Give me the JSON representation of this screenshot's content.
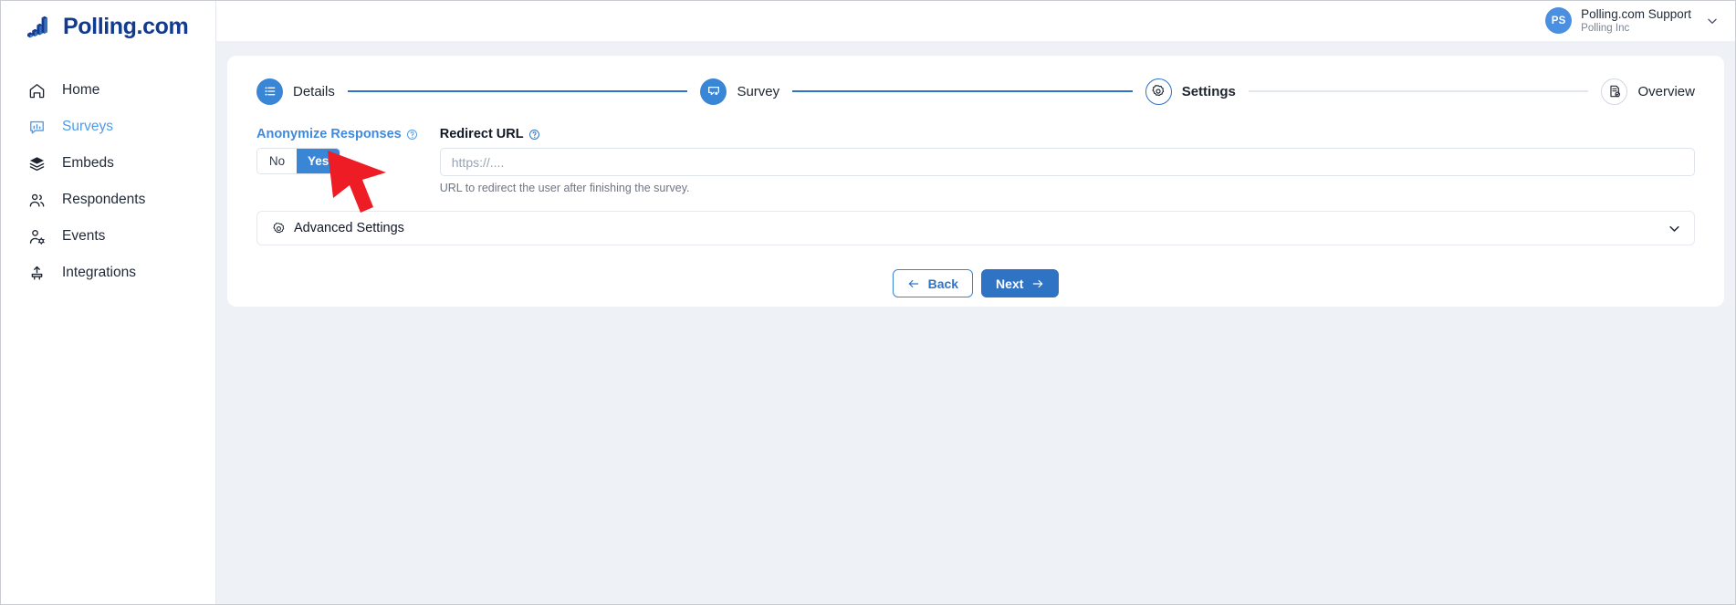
{
  "brand": {
    "name": "Polling.com",
    "logo_icon": "bar-chart-logo-icon"
  },
  "sidebar": {
    "items": [
      {
        "label": "Home",
        "icon": "home-icon",
        "active": false
      },
      {
        "label": "Surveys",
        "icon": "survey-chart-icon",
        "active": true
      },
      {
        "label": "Embeds",
        "icon": "layers-icon",
        "active": false
      },
      {
        "label": "Respondents",
        "icon": "users-icon",
        "active": false
      },
      {
        "label": "Events",
        "icon": "user-gear-icon",
        "active": false
      },
      {
        "label": "Integrations",
        "icon": "plug-upload-icon",
        "active": false
      }
    ]
  },
  "topbar": {
    "account": {
      "initials": "PS",
      "name": "Polling.com Support",
      "org": "Polling Inc",
      "caret_icon": "chevron-down-icon"
    }
  },
  "stepper": {
    "steps": [
      {
        "label": "Details",
        "icon": "list-icon",
        "state": "done"
      },
      {
        "label": "Survey",
        "icon": "survey-search-icon",
        "state": "done"
      },
      {
        "label": "Settings",
        "icon": "gear-icon",
        "state": "current"
      },
      {
        "label": "Overview",
        "icon": "document-check-icon",
        "state": "todo"
      }
    ]
  },
  "form": {
    "anonymize": {
      "label": "Anonymize Responses",
      "help_icon": "help-circle-icon",
      "options": [
        "No",
        "Yes"
      ],
      "selected": "Yes"
    },
    "redirect_url": {
      "label": "Redirect URL",
      "help_icon": "help-circle-icon",
      "value": "",
      "placeholder": "https://....",
      "hint": "URL to redirect the user after finishing the survey."
    },
    "advanced": {
      "label": "Advanced Settings",
      "gear_icon": "gear-icon",
      "chevron_icon": "chevron-down-icon",
      "expanded": false
    }
  },
  "actions": {
    "back_label": "Back",
    "back_icon": "arrow-left-icon",
    "next_label": "Next",
    "next_icon": "arrow-right-icon"
  },
  "annotation": {
    "cursor_icon": "red-cursor-arrow",
    "color": "#ee1c25"
  },
  "colors": {
    "accent_blue": "#2f73c4",
    "step_blue": "#3a86d6",
    "link_blue": "#4f9bea",
    "brand_navy": "#123a8f",
    "canvas_bg": "#eef1f5",
    "annotation_red": "#ee1c25"
  }
}
